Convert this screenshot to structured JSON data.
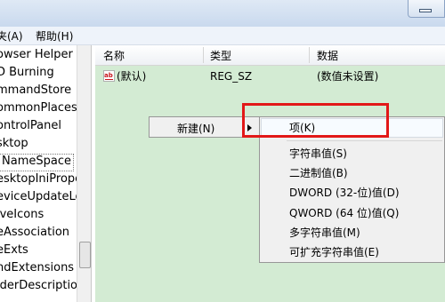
{
  "menubar": {
    "items": [
      "夹(A)",
      "帮助(H)"
    ]
  },
  "tree": {
    "items": [
      "owser Helper O",
      "D Burning",
      "mmandStore",
      "ommonPlaces",
      "ontrolPanel",
      "sktop",
      "NameSpace",
      "esktopIniPrope",
      "eviceUpdateLoc",
      "iveIcons",
      "eAssociation",
      "eExts",
      "ndExtensions",
      "lderDescription"
    ]
  },
  "list": {
    "headers": {
      "name": "名称",
      "type": "类型",
      "data": "数据"
    },
    "rows": [
      {
        "name": "(默认)",
        "type": "REG_SZ",
        "data": "(数值未设置)"
      }
    ]
  },
  "context_menu": {
    "new_label": "新建(N)"
  },
  "submenu": {
    "items": [
      "项(K)",
      "字符串值(S)",
      "二进制值(B)",
      "DWORD (32-位)值(D)",
      "QWORD (64 位)值(Q)",
      "多字符串值(M)",
      "可扩充字符串值(E)"
    ]
  },
  "colors": {
    "highlight_box": "#e21818",
    "list_background": "#d3ebd3"
  }
}
